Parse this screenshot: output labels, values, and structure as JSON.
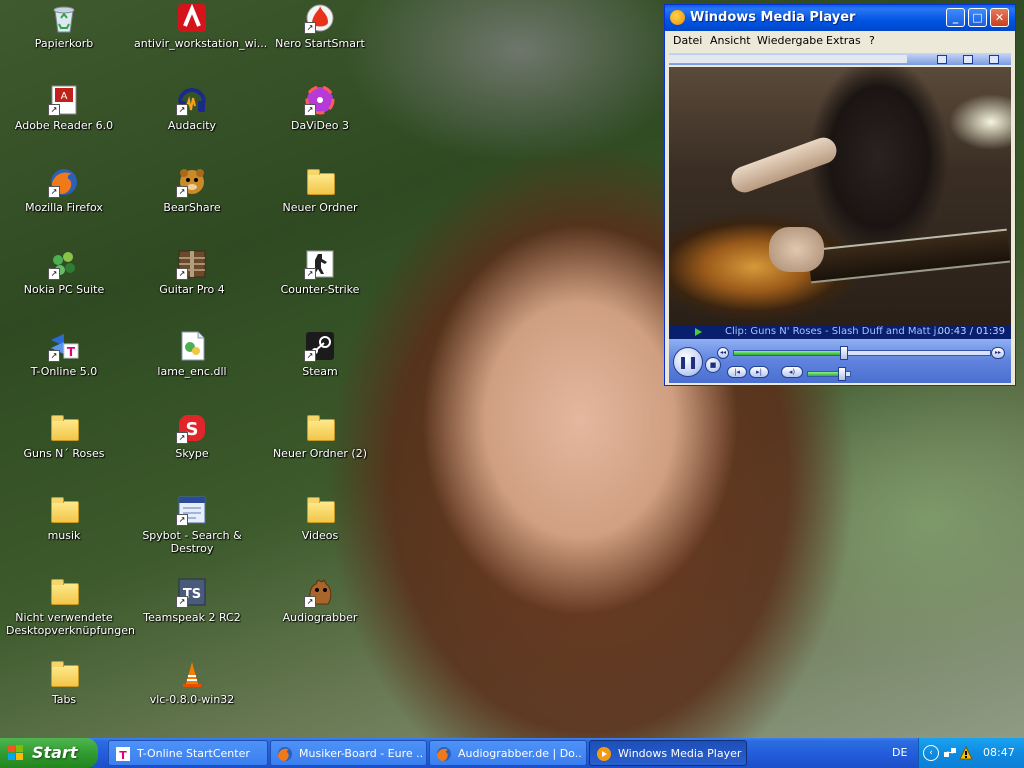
{
  "desktop": {
    "icons": [
      {
        "label": "Papierkorb"
      },
      {
        "label": "antivir_workstation_wi..."
      },
      {
        "label": "Nero StartSmart"
      },
      {
        "label": "Adobe Reader 6.0"
      },
      {
        "label": "Audacity"
      },
      {
        "label": "DaViDeo 3"
      },
      {
        "label": "Mozilla Firefox"
      },
      {
        "label": "BearShare"
      },
      {
        "label": "Neuer Ordner"
      },
      {
        "label": "Nokia PC Suite"
      },
      {
        "label": "Guitar Pro 4"
      },
      {
        "label": "Counter-Strike"
      },
      {
        "label": "T-Online 5.0"
      },
      {
        "label": "lame_enc.dll"
      },
      {
        "label": "Steam"
      },
      {
        "label": "Guns N´ Roses"
      },
      {
        "label": "Skype"
      },
      {
        "label": "Neuer Ordner (2)"
      },
      {
        "label": "musik"
      },
      {
        "label": "Spybot - Search & Destroy"
      },
      {
        "label": "Videos"
      },
      {
        "label": "Nicht verwendete Desktopverknüpfungen"
      },
      {
        "label": "Teamspeak 2 RC2"
      },
      {
        "label": "Audiograbber"
      },
      {
        "label": "Tabs"
      },
      {
        "label": "vlc-0.8.0-win32"
      }
    ]
  },
  "wmp": {
    "title": "Windows Media Player",
    "menu": [
      "Datei",
      "Ansicht",
      "Wiedergabe",
      "Extras",
      "?"
    ],
    "clip": "Clip: Guns N' Roses - Slash Duff and Matt j...",
    "time": "00:43 / 01:39",
    "seek_progress": 0.43,
    "volume": 0.8,
    "colors": {
      "title_bar": "#0054e3",
      "status_bg": "#0a1e6e",
      "status_text": "#9fc3ff"
    }
  },
  "taskbar": {
    "start_label": "Start",
    "tasks": [
      {
        "label": "T-Online StartCenter"
      },
      {
        "label": "Musiker-Board - Eure ..."
      },
      {
        "label": "Audiograbber.de | Do..."
      },
      {
        "label": "Windows Media Player"
      }
    ],
    "language": "DE",
    "clock": "08:47"
  }
}
